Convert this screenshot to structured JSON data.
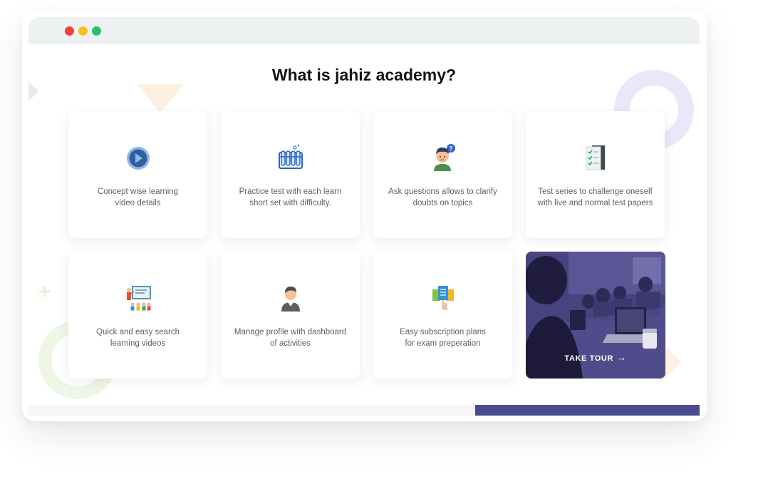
{
  "window": {
    "controls": [
      "close",
      "minimize",
      "maximize"
    ],
    "colors": {
      "close": "#e8473a",
      "minimize": "#f4c019",
      "maximize": "#27c06b"
    }
  },
  "heading": "What is jahiz academy?",
  "features": [
    {
      "icon": "play-video-icon",
      "line1": "Concept wise learning",
      "line2": "video details"
    },
    {
      "icon": "test-tubes-icon",
      "line1": "Practice test with each learn",
      "line2": "short set with difficulty."
    },
    {
      "icon": "question-student-icon",
      "line1": "Ask questions allows to clarify",
      "line2": "doubts on topics"
    },
    {
      "icon": "checklist-icon",
      "line1": "Test series to challenge oneself",
      "line2": "with live and normal test papers"
    },
    {
      "icon": "classroom-teacher-icon",
      "line1": "Quick and easy search",
      "line2": "learning videos"
    },
    {
      "icon": "user-profile-icon",
      "line1": "Manage profile with dashboard",
      "line2": "of activities"
    },
    {
      "icon": "subscription-plans-icon",
      "line1": "Easy subscription plans",
      "line2": "for exam preperation"
    }
  ],
  "tour": {
    "label": "TAKE TOUR",
    "icon": "arrow-right-icon"
  },
  "colors": {
    "accent": "#4a4a8e",
    "heading": "#141414",
    "text": "#5c6166"
  }
}
